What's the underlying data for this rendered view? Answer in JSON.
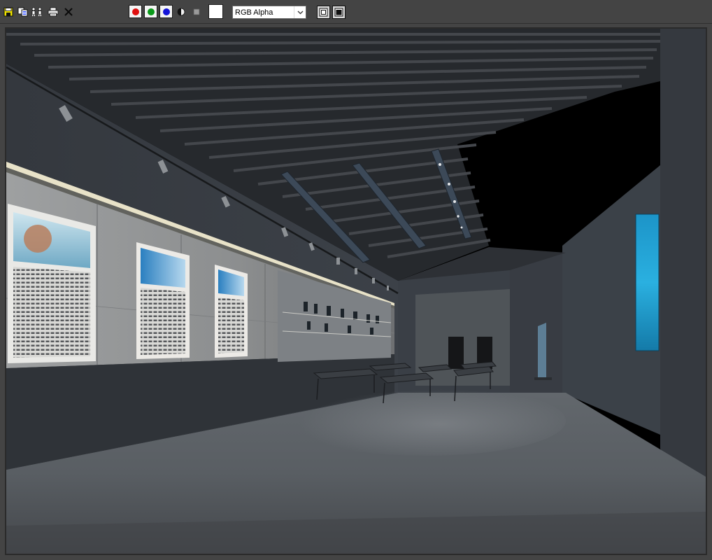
{
  "toolbar": {
    "tools": [
      {
        "id": "save",
        "icon": "save-disk-icon"
      },
      {
        "id": "copy",
        "icon": "copy-image-icon"
      },
      {
        "id": "clone",
        "icon": "clone-frame-window-icon"
      },
      {
        "id": "print",
        "icon": "print-icon"
      },
      {
        "id": "clear",
        "icon": "clear-x-icon"
      }
    ],
    "channels": [
      {
        "id": "red",
        "icon": "red-channel-icon",
        "color": "#e01010"
      },
      {
        "id": "green",
        "icon": "green-channel-icon",
        "color": "#0a9a1a"
      },
      {
        "id": "blue",
        "icon": "blue-channel-icon",
        "color": "#1414d8"
      }
    ],
    "mono_icon": "monochrome-icon",
    "alpha_icon": "alpha-toggle-icon",
    "swatch_color": "#ffffff",
    "channel_display": {
      "selected": "RGB Alpha"
    },
    "frame_buttons": [
      {
        "id": "overlay",
        "icon": "display-overlay-icon"
      },
      {
        "id": "background",
        "icon": "display-background-icon"
      }
    ]
  },
  "render": {
    "icon": "rendered-exhibition-hall-image",
    "colors": {
      "ceiling": "#1d1f22",
      "wall": "#3b4047",
      "floor": "#5e6369",
      "sky": "#000000",
      "screen": "#1a8fc4"
    }
  }
}
